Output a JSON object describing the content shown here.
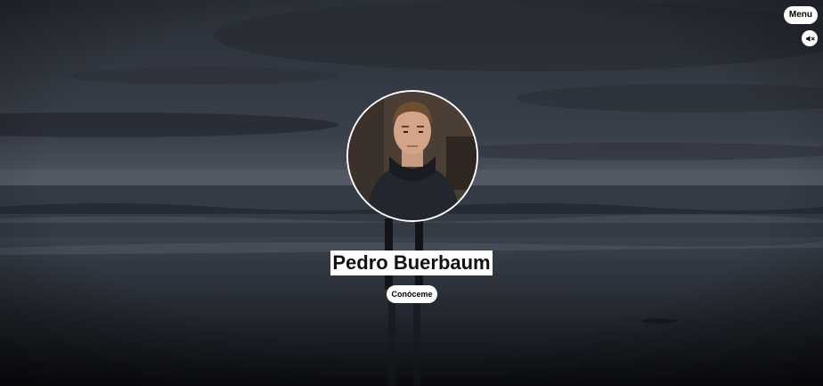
{
  "header": {
    "menu_label": "Menu",
    "mute_icon": "speaker-muted-icon"
  },
  "hero": {
    "name": "Pedro Buerbaum",
    "cta_label": "Conóceme",
    "avatar_icon": "profile-photo"
  },
  "colors": {
    "button_bg": "#ffffff",
    "button_text": "#000000",
    "background": "#2b3039"
  }
}
